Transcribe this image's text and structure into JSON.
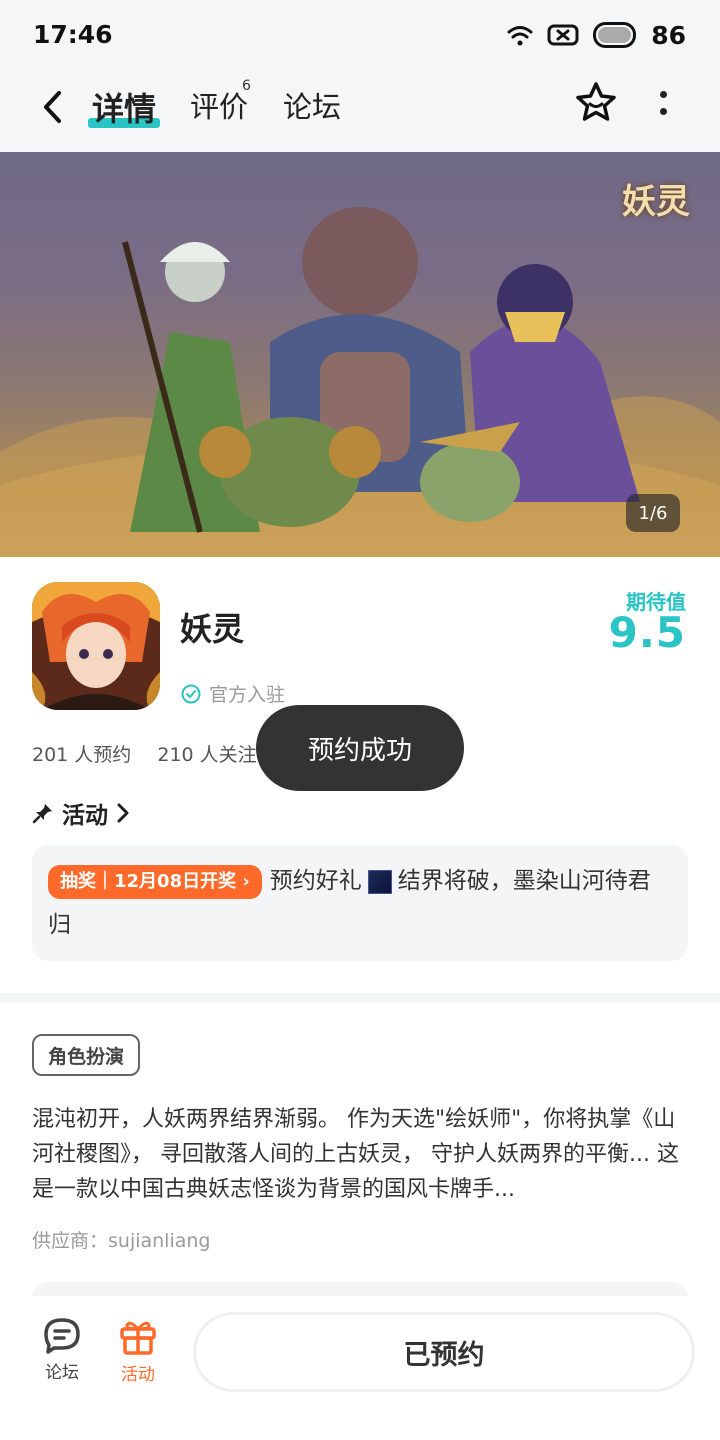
{
  "status_bar": {
    "time": "17:46",
    "battery": "86"
  },
  "nav": {
    "tabs": [
      {
        "label": "详情",
        "active": true
      },
      {
        "label": "评价",
        "badge": "6"
      },
      {
        "label": "论坛"
      }
    ],
    "accent_color": "#2bc4c4"
  },
  "banner": {
    "logo_text": "妖灵",
    "counter": "1/6"
  },
  "game": {
    "name": "妖灵",
    "official_label": "官方入驻",
    "expect_label": "期待值",
    "expect_value": "9.5",
    "reservations": "201 人预约",
    "followers": "210 人关注"
  },
  "toast": "预约成功",
  "activity": {
    "title": "活动",
    "badge": "抽奖｜12月08日开奖 ›",
    "text_prefix": "预约好礼",
    "text_main": "结界将破，墨染山河待君归"
  },
  "genre_tag": "角色扮演",
  "description": "混沌初开，人妖两界结界渐弱。 作为天选\"绘妖师\"，你将执掌《山河社稷图》， 寻回散落人间的上古妖灵， 守护人妖两界的平衡... 这是一款以中国古典妖志怪谈为背景的国风卡牌手...",
  "supplier": "供应商：sujianliang",
  "bottom_bar": {
    "forum_label": "论坛",
    "activity_label": "活动",
    "reserved_label": "已预约",
    "activity_color": "#ff6a2b"
  }
}
